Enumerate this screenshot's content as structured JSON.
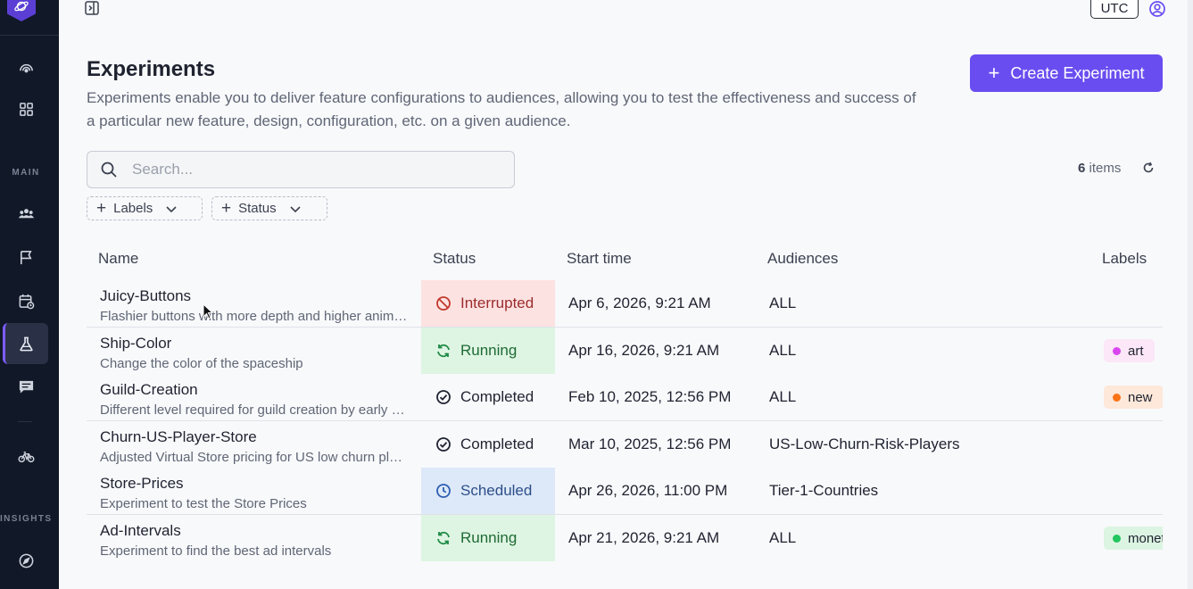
{
  "sidebar": {
    "sections": {
      "main": "MAIN",
      "insights": "INSIGHTS"
    },
    "items": [
      {
        "icon": "dashboard-gauge-icon"
      },
      {
        "icon": "apps-grid-icon"
      },
      {
        "icon": "users-icon"
      },
      {
        "icon": "flag-icon"
      },
      {
        "icon": "calendar-clock-icon"
      },
      {
        "icon": "flask-icon",
        "active": true
      },
      {
        "icon": "message-list-icon"
      },
      {
        "icon": "bicycle-icon"
      },
      {
        "icon": "compass-icon"
      }
    ]
  },
  "header": {
    "timezone": "UTC"
  },
  "page": {
    "title": "Experiments",
    "description": "Experiments enable you to deliver feature configurations to audiences, allowing you to test the effectiveness and success of a particular new feature, design, configuration, etc. on a given audience.",
    "create_label": "Create Experiment"
  },
  "search": {
    "placeholder": "Search..."
  },
  "count": {
    "number": "6",
    "suffix": " items"
  },
  "filters": {
    "labels": "Labels",
    "status": "Status"
  },
  "table": {
    "columns": {
      "name": "Name",
      "status": "Status",
      "start": "Start time",
      "audiences": "Audiences",
      "labels": "Labels"
    },
    "rows": [
      {
        "name": "Juicy-Buttons",
        "sub": "Flashier buttons with more depth and higher animation",
        "status": "Interrupted",
        "start": "Apr 6, 2026, 9:21 AM",
        "audience": "ALL",
        "label": "",
        "label_color": ""
      },
      {
        "name": "Ship-Color",
        "sub": "Change the color of the spaceship",
        "status": "Running",
        "start": "Apr 16, 2026, 9:21 AM",
        "audience": "ALL",
        "label": "art",
        "label_color": "#d946ef"
      },
      {
        "name": "Guild-Creation",
        "sub": "Different level required for guild creation by early players",
        "status": "Completed",
        "start": "Feb 10, 2025, 12:56 PM",
        "audience": "ALL",
        "label": "new",
        "label_color": "#f97316"
      },
      {
        "name": "Churn-US-Player-Store",
        "sub": "Adjusted Virtual Store pricing for US low churn players",
        "status": "Completed",
        "start": "Mar 10, 2025, 12:56 PM",
        "audience": "US-Low-Churn-Risk-Players",
        "label": "",
        "label_color": ""
      },
      {
        "name": "Store-Prices",
        "sub": "Experiment to test the Store Prices",
        "status": "Scheduled",
        "start": "Apr 26, 2026, 11:00 PM",
        "audience": "Tier-1-Countries",
        "label": "",
        "label_color": ""
      },
      {
        "name": "Ad-Intervals",
        "sub": "Experiment to find the best ad intervals",
        "status": "Running",
        "start": "Apr 21, 2026, 9:21 AM",
        "audience": "ALL",
        "label": "monetization",
        "label_color": "#22c55e"
      }
    ]
  },
  "colors": {
    "accent": "#6a4df0",
    "sidebar": "#111827",
    "interrupted": "#fde2e2",
    "running": "#dff5e3",
    "scheduled": "#dde8f8"
  }
}
